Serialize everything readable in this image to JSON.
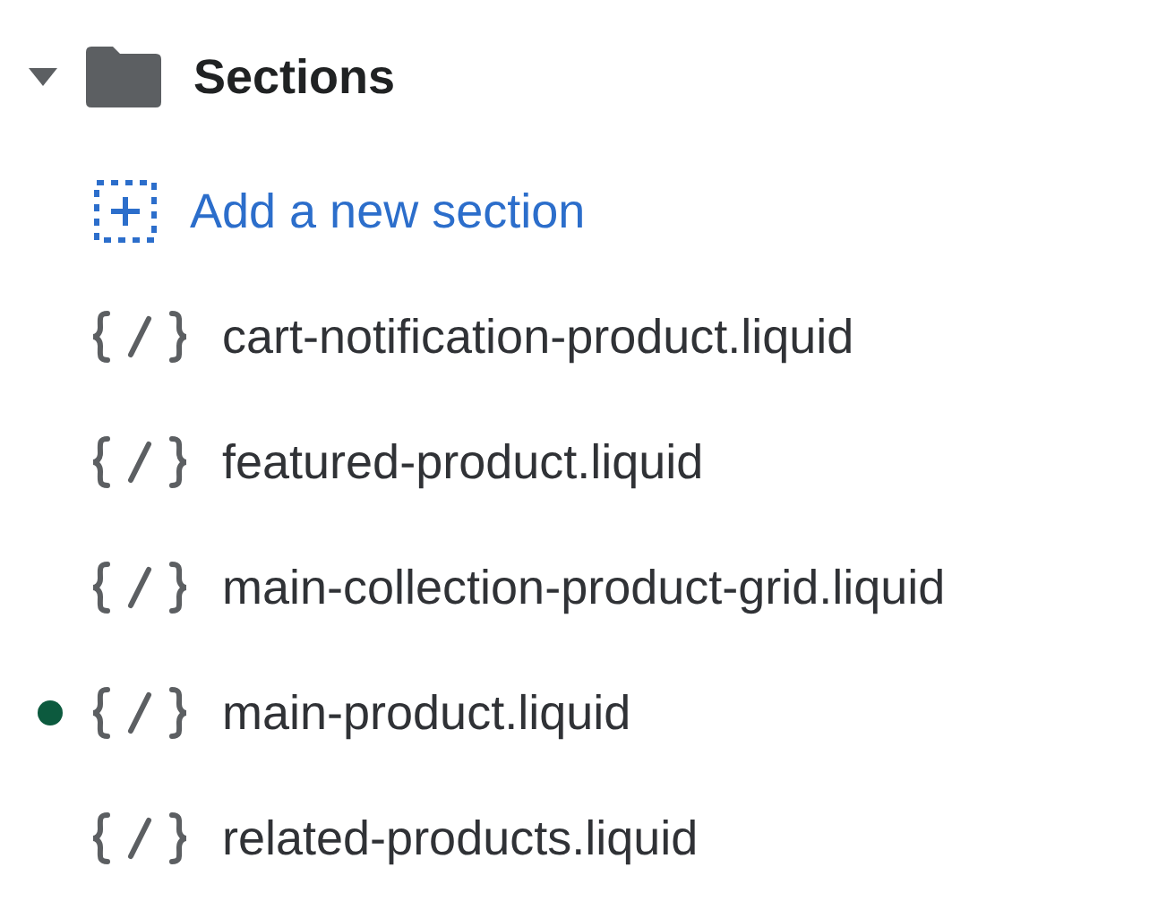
{
  "folder": {
    "name": "Sections",
    "expanded": true
  },
  "items": [
    {
      "kind": "add",
      "label": "Add a new section",
      "modified": false
    },
    {
      "kind": "file",
      "label": "cart-notification-product.liquid",
      "modified": false
    },
    {
      "kind": "file",
      "label": "featured-product.liquid",
      "modified": false
    },
    {
      "kind": "file",
      "label": "main-collection-product-grid.liquid",
      "modified": false
    },
    {
      "kind": "file",
      "label": "main-product.liquid",
      "modified": true
    },
    {
      "kind": "file",
      "label": "related-products.liquid",
      "modified": false
    }
  ]
}
